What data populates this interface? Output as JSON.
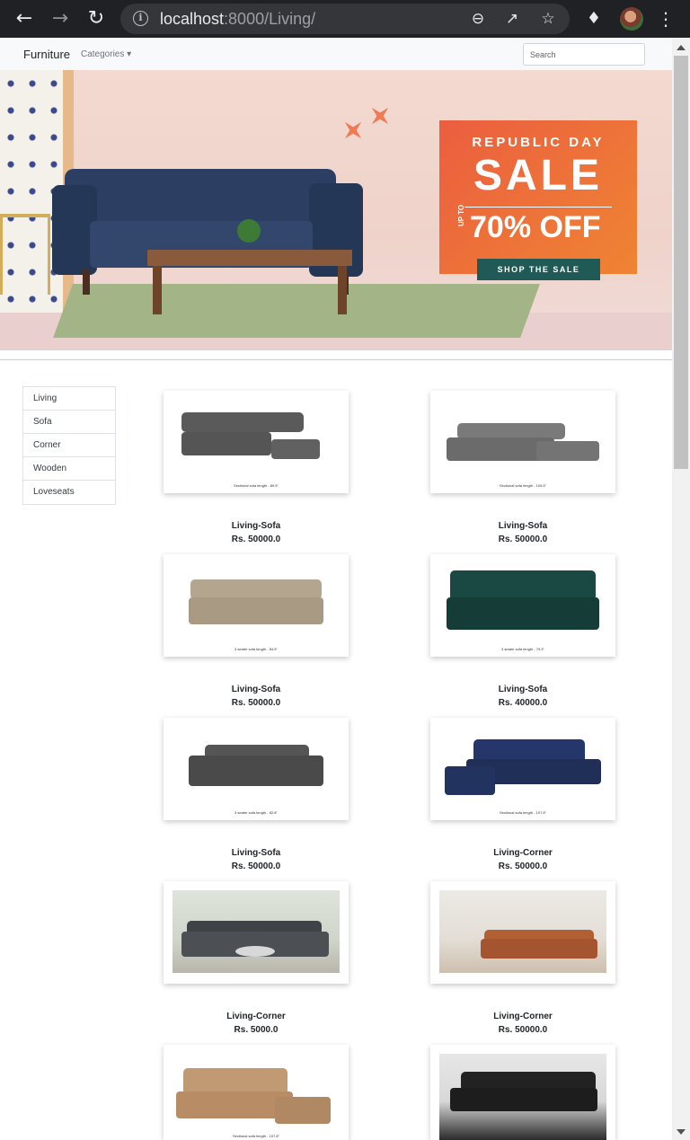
{
  "browser": {
    "url_host": "localhost",
    "url_rest": ":8000/Living/",
    "icons": [
      "back-arrow-icon",
      "forward-arrow-icon",
      "reload-icon",
      "info-icon",
      "zoom-out-icon",
      "share-icon",
      "star-icon",
      "extensions-icon",
      "profile-avatar",
      "menu-icon"
    ]
  },
  "navbar": {
    "brand": "Furniture",
    "categories_label": "Categories",
    "search_placeholder": "Search"
  },
  "banner": {
    "line1": "REPUBLIC DAY",
    "line2": "SALE",
    "upto": "UP TO",
    "discount": "70% OFF",
    "cta": "SHOP THE SALE",
    "colors": {
      "sale_orange": "#eb5e3f",
      "cta_green": "#1f5a56",
      "sofa_navy": "#2c3f63"
    }
  },
  "sidebar": {
    "items": [
      "Living",
      "Sofa",
      "Corner",
      "Wooden",
      "Loveseats"
    ]
  },
  "products": [
    {
      "name": "Living-Sofa",
      "price": "Rs. 50000.0",
      "caption": "Sectional sofa length - 89.5\"",
      "color": "#555555"
    },
    {
      "name": "Living-Sofa",
      "price": "Rs. 50000.0",
      "caption": "Sectional sofa length - 105.5\"",
      "color": "#6b6b6b"
    },
    {
      "name": "Living-Sofa",
      "price": "Rs. 50000.0",
      "caption": "3 seater sofa length - 84.5\"",
      "color": "#a89a83"
    },
    {
      "name": "Living-Sofa",
      "price": "Rs. 40000.0",
      "caption": "3 seater sofa length - 79.3\"",
      "color": "#153c37"
    },
    {
      "name": "Living-Sofa",
      "price": "Rs. 50000.0",
      "caption": "3 seater sofa length - 82.8\"",
      "color": "#4a4a4a"
    },
    {
      "name": "Living-Corner",
      "price": "Rs. 50000.0",
      "caption": "Sectional sofa length - 107.8\"",
      "color": "#1f2f57"
    },
    {
      "name": "Living-Corner",
      "price": "Rs. 5000.0",
      "caption": "",
      "color": "#4c4f53"
    },
    {
      "name": "Living-Corner",
      "price": "Rs. 50000.0",
      "caption": "",
      "color": "#a4542e"
    },
    {
      "name": "",
      "price": "",
      "caption": "Sectional sofa length - 107.8\"",
      "color": "#b88d66"
    },
    {
      "name": "",
      "price": "",
      "caption": "",
      "color": "#1d1d1d"
    }
  ]
}
